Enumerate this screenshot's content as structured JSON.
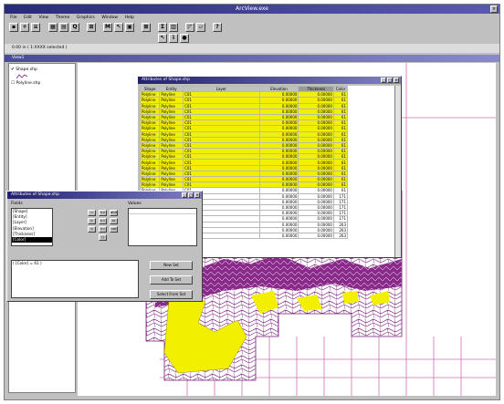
{
  "app": {
    "title": "ArcView.exe"
  },
  "menu": [
    "File",
    "Edit",
    "View",
    "Theme",
    "Graphics",
    "Window",
    "Help"
  ],
  "status": {
    "text": "0.00 in   ( 1:XXXX selected )"
  },
  "inner_title": "View1",
  "layers": [
    {
      "label": "Shape.shp",
      "checked": true
    },
    {
      "label": "Polyline.shp",
      "checked": false
    }
  ],
  "table_window": {
    "title": "Attributes of Shape.shp",
    "columns": [
      "Shape",
      "Entity",
      "Layer",
      "Elevation",
      "Thickness",
      "Color"
    ],
    "rows": [
      {
        "shape": "Polyline",
        "entity": "Polyline",
        "layer": "C01",
        "elev": "0.00000",
        "thick": "0.00000",
        "color": "61",
        "selected": true
      },
      {
        "shape": "Polyline",
        "entity": "Polyline",
        "layer": "C01",
        "elev": "0.00000",
        "thick": "0.00000",
        "color": "61",
        "selected": true
      },
      {
        "shape": "Polyline",
        "entity": "Polyline",
        "layer": "C01",
        "elev": "0.00000",
        "thick": "0.00000",
        "color": "61",
        "selected": true
      },
      {
        "shape": "Polyline",
        "entity": "Polyline",
        "layer": "C01",
        "elev": "0.00000",
        "thick": "0.00000",
        "color": "61",
        "selected": true
      },
      {
        "shape": "Polyline",
        "entity": "Polyline",
        "layer": "C01",
        "elev": "0.00000",
        "thick": "0.00000",
        "color": "61",
        "selected": true
      },
      {
        "shape": "Polyline",
        "entity": "Polyline",
        "layer": "C01",
        "elev": "0.00000",
        "thick": "0.00000",
        "color": "61",
        "selected": true
      },
      {
        "shape": "Polyline",
        "entity": "Polyline",
        "layer": "C01",
        "elev": "0.00000",
        "thick": "0.00000",
        "color": "61",
        "selected": true
      },
      {
        "shape": "Polyline",
        "entity": "Polyline",
        "layer": "C01",
        "elev": "0.00000",
        "thick": "0.00000",
        "color": "61",
        "selected": true
      },
      {
        "shape": "Polyline",
        "entity": "Polyline",
        "layer": "C01",
        "elev": "0.00000",
        "thick": "0.00000",
        "color": "61",
        "selected": true
      },
      {
        "shape": "Polyline",
        "entity": "Polyline",
        "layer": "C01",
        "elev": "0.00000",
        "thick": "0.00000",
        "color": "61",
        "selected": true
      },
      {
        "shape": "Polyline",
        "entity": "Polyline",
        "layer": "C01",
        "elev": "0.00000",
        "thick": "0.00000",
        "color": "61",
        "selected": true
      },
      {
        "shape": "Polyline",
        "entity": "Polyline",
        "layer": "C01",
        "elev": "0.00000",
        "thick": "0.00000",
        "color": "61",
        "selected": true
      },
      {
        "shape": "Polyline",
        "entity": "Polyline",
        "layer": "C01",
        "elev": "0.00000",
        "thick": "0.00000",
        "color": "61",
        "selected": true
      },
      {
        "shape": "Polyline",
        "entity": "Polyline",
        "layer": "C01",
        "elev": "0.00000",
        "thick": "0.00000",
        "color": "61",
        "selected": true
      },
      {
        "shape": "Polyline",
        "entity": "Polyline",
        "layer": "C01",
        "elev": "0.00000",
        "thick": "0.00000",
        "color": "61",
        "selected": true
      },
      {
        "shape": "Polyline",
        "entity": "Polyline",
        "layer": "C01",
        "elev": "0.00000",
        "thick": "0.00000",
        "color": "61",
        "selected": true
      },
      {
        "shape": "Polyline",
        "entity": "Polyline",
        "layer": "C01",
        "elev": "0.00000",
        "thick": "0.00000",
        "color": "61",
        "selected": true
      },
      {
        "shape": "Polyline",
        "entity": "Polyline",
        "layer": "C01",
        "elev": "0.00000",
        "thick": "0.00000",
        "color": "61",
        "selected": false
      },
      {
        "shape": "Polyline",
        "entity": "Polyline",
        "layer": "C01",
        "elev": "0.00000",
        "thick": "0.00000",
        "color": "171",
        "selected": false
      },
      {
        "shape": "Polyline",
        "entity": "Polyline",
        "layer": "C01",
        "elev": "0.00000",
        "thick": "0.00000",
        "color": "171",
        "selected": false
      },
      {
        "shape": "Polyline",
        "entity": "Polyline",
        "layer": "C01",
        "elev": "0.00000",
        "thick": "0.00000",
        "color": "171",
        "selected": false
      },
      {
        "shape": "Polyline",
        "entity": "Polyline",
        "layer": "C01",
        "elev": "0.00000",
        "thick": "0.00000",
        "color": "171",
        "selected": false
      },
      {
        "shape": "Polyline",
        "entity": "Polyline",
        "layer": "C01",
        "elev": "0.00000",
        "thick": "0.00000",
        "color": "171",
        "selected": false
      },
      {
        "shape": "Polyline",
        "entity": "Polyline",
        "layer": "C01",
        "elev": "0.00000",
        "thick": "0.00000",
        "color": "263",
        "selected": false
      },
      {
        "shape": "Polyline",
        "entity": "Polyline",
        "layer": "C01",
        "elev": "0.00000",
        "thick": "0.00000",
        "color": "263",
        "selected": false
      },
      {
        "shape": "Polyline",
        "entity": "Polyline",
        "layer": "C01",
        "elev": "0.00000",
        "thick": "0.00000",
        "color": "263",
        "selected": false
      }
    ]
  },
  "query_dialog": {
    "title": "Attributes of Shape.shp",
    "fields_label": "Fields",
    "values_label": "Values",
    "fields": [
      "[Shape]",
      "[Entity]",
      "[Layer]",
      "[Elevation]",
      "[Thickness]",
      "[Color]"
    ],
    "highlighted_field": 5,
    "operators": [
      "=",
      "<>",
      "and",
      ">",
      ">=",
      "or",
      "<",
      "<=",
      "not",
      "()"
    ],
    "expression": "( [Color] = 61 )",
    "new_set_label": "New Set",
    "add_to_set_label": "Add To Set",
    "select_from_set_label": "Select From Set"
  },
  "colors": {
    "selection": "#f2f000",
    "map_lines": "#7a1a7a",
    "grid": "#d070b0"
  }
}
